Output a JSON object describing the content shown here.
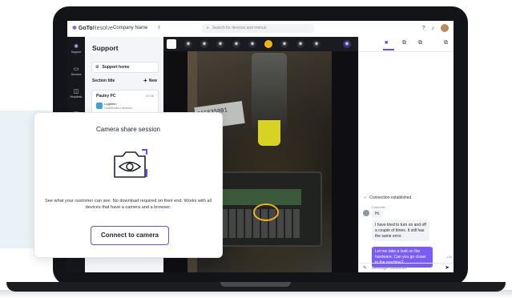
{
  "app": {
    "brand_bold": "GoTo",
    "brand_light": "Resolve",
    "company": "Company Name",
    "search_placeholder": "Search for devices and menus"
  },
  "nav": {
    "items": [
      {
        "label": "Support",
        "icon": "support-icon"
      },
      {
        "label": "Devices",
        "icon": "devices-icon"
      },
      {
        "label": "Helpdesk",
        "icon": "helpdesk-icon"
      },
      {
        "label": "Remote Execution",
        "icon": "remote-execution-icon"
      }
    ]
  },
  "support": {
    "title": "Support",
    "home_label": "Support home",
    "section_title": "Section title",
    "new_label": "New",
    "session": {
      "name": "Pauley PC",
      "time": "03:06",
      "app": "LogMeIn",
      "status": "Unattended session"
    }
  },
  "chat": {
    "system_message": "Connection established.",
    "customer_label": "Customer",
    "messages": [
      {
        "from": "customer",
        "text": "Hi."
      },
      {
        "from": "customer",
        "text": "I have tried to turn on and off a couple of times. It still has the same error."
      },
      {
        "from": "agent",
        "text": "Let me take a look on the hardware. Can you go closer to the machine?"
      }
    ],
    "agent_tag": "UN",
    "compose_placeholder": "Message Customer"
  },
  "video": {
    "sticker_text": "01S535001"
  },
  "popup": {
    "title": "Camera share session",
    "body": "See what your customer can see. No download required on their end. Works with all devices that have a camera and a browser.",
    "button": "Connect to camera",
    "accent": "#6b49f6"
  }
}
